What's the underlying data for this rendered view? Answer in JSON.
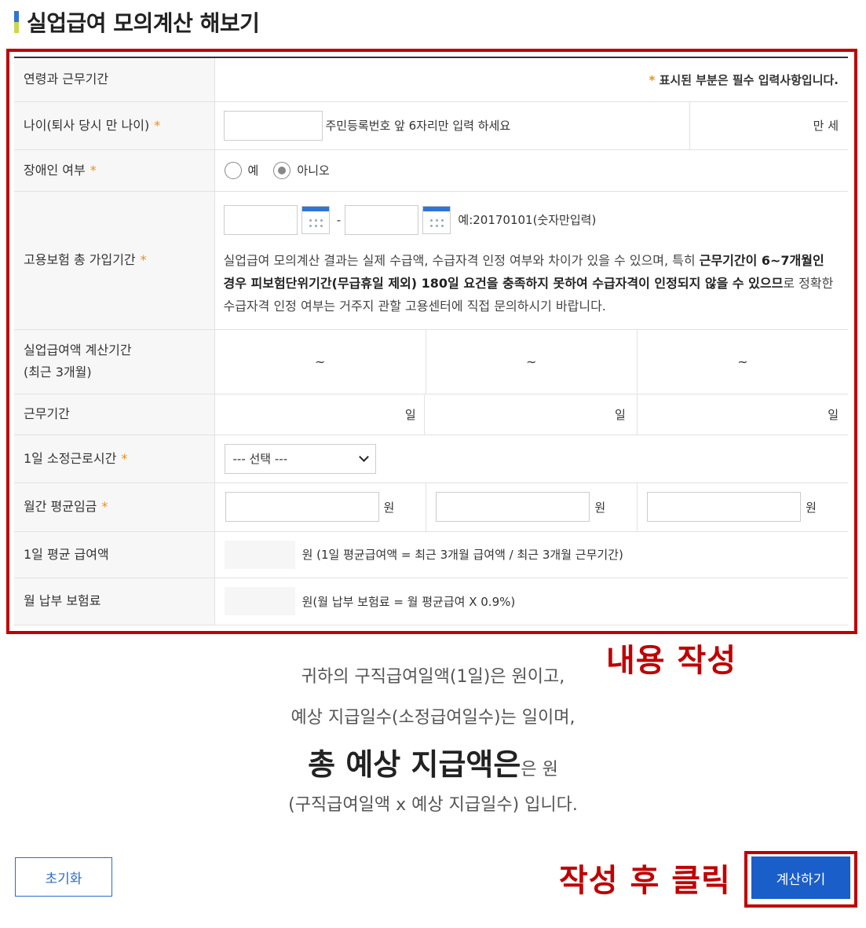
{
  "page_title": "실업급여 모의계산 해보기",
  "form": {
    "header_label": "연령과 근무기간",
    "required_note_star": "*",
    "required_note": "표시된 부분은 필수 입력사항입니다.",
    "age": {
      "label": "나이(퇴사 당시 만 나이)",
      "hint": "주민등록번호 앞 6자리만 입력 하세요",
      "unit": "만 세"
    },
    "disability": {
      "label": "장애인 여부",
      "options": [
        "예",
        "아니오"
      ],
      "selected": "아니오"
    },
    "insurance_period": {
      "label": "고용보험 총 가입기간",
      "separator": "-",
      "example": "예:20170101(숫자만입력)",
      "desc_1": "실업급여 모의계산 결과는 실제 수급액, 수급자격 인정 여부와 차이가 있을 수 있으며, 특히 ",
      "desc_bold": "근무기간이 6~7개월인 경우 피보험단위기간(무급휴일 제외) 180일 요건을 충족하지 못하여 수급자격이 인정되지 않을 수 있으므",
      "desc_2": "로 정확한 수급자격 인정 여부는 거주지 관할 고용센터에 직접 문의하시기 바랍니다."
    },
    "calc_period": {
      "label_line1": "실업급여액 계산기간",
      "label_line2": "(최근 3개월)",
      "cells": [
        "~",
        "~",
        "~"
      ]
    },
    "work_period": {
      "label": "근무기간",
      "unit": "일"
    },
    "daily_hours": {
      "label": "1일 소정근로시간",
      "selected": "--- 선택 ---"
    },
    "monthly_wage": {
      "label": "월간 평균임금",
      "unit": "원"
    },
    "daily_avg": {
      "label": "1일 평균 급여액",
      "text": "원 (1일 평균급여액 = 최근 3개월 급여액 / 최근 3개월 근무기간)"
    },
    "monthly_premium": {
      "label": "월 납부 보험료",
      "text": "원(월 납부 보험료 = 월 평균급여 X 0.9%)"
    }
  },
  "annotations": {
    "write": "내용 작성",
    "click": "작성 후 클릭"
  },
  "result": {
    "line1": "귀하의 구직급여일액(1일)은 원이고,",
    "line2": "예상 지급일수(소정급여일수)는 일이며,",
    "line3_bold": "총 예상 지급액은",
    "line3_small": "은 원",
    "line4": "(구직급여일액 x 예상 지급일수) 입니다."
  },
  "buttons": {
    "reset": "초기화",
    "calculate": "계산하기"
  },
  "colors": {
    "accent_red": "#c00000",
    "primary_blue": "#1a5fc9",
    "required_orange": "#f08c14"
  }
}
